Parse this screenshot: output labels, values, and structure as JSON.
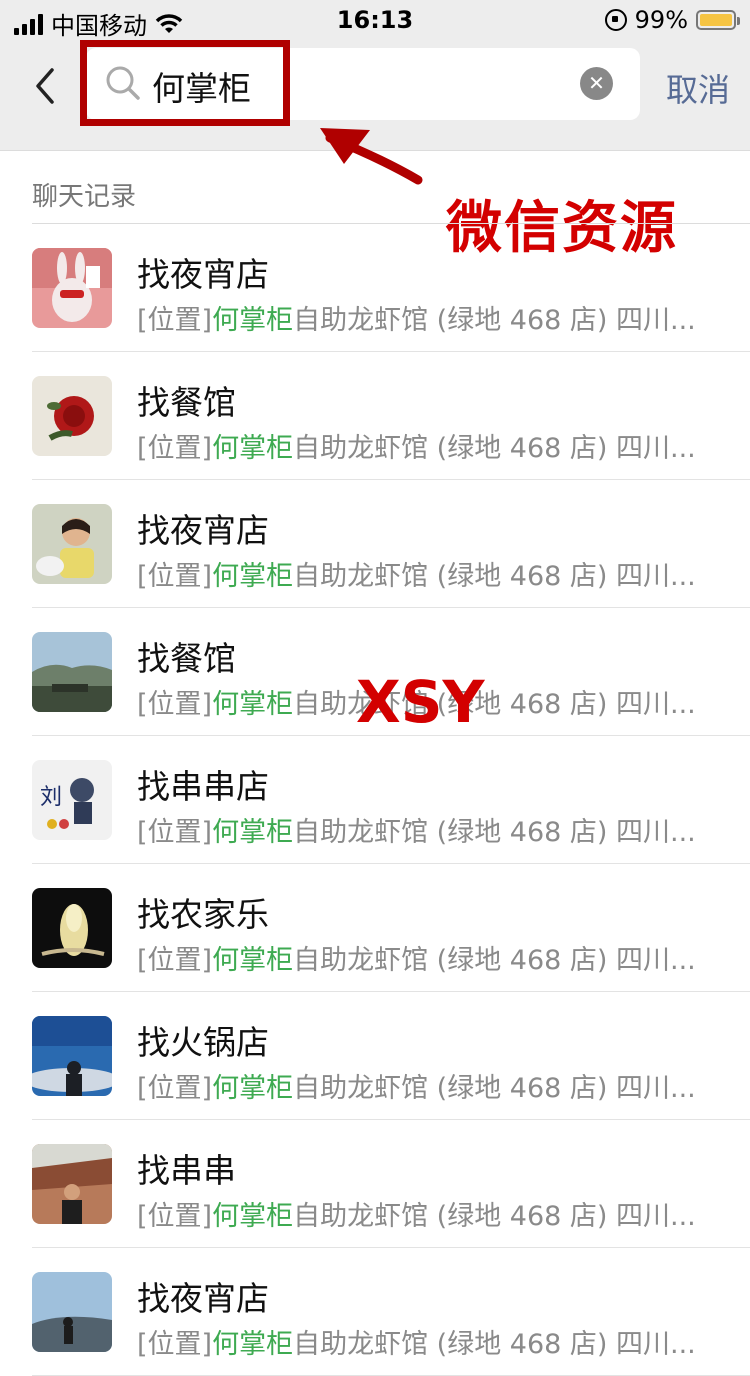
{
  "status_bar": {
    "carrier": "中国移动",
    "time": "16:13",
    "battery": "99%",
    "battery_level": 0.99
  },
  "search": {
    "query": "何掌柜",
    "cancel_label": "取消"
  },
  "annotations": {
    "title": "微信资源",
    "watermark": "XSY",
    "frame_color": "#b00000",
    "text_color": "#d30000"
  },
  "section": {
    "title": "聊天记录"
  },
  "colors": {
    "accent_link": "#576b95",
    "keyword": "#3eaa51",
    "snippet": "#8a8a8a"
  },
  "results": [
    {
      "name": "找夜宵店",
      "prefix": "[位置]",
      "keyword": "何掌柜",
      "rest": "自助龙虾馆 (绿地 468 店) 四川...",
      "avatar": "rabbit-avatar"
    },
    {
      "name": "找餐馆",
      "prefix": "[位置]",
      "keyword": "何掌柜",
      "rest": "自助龙虾馆 (绿地 468 店) 四川...",
      "avatar": "rose-avatar"
    },
    {
      "name": "找夜宵店",
      "prefix": "[位置]",
      "keyword": "何掌柜",
      "rest": "自助龙虾馆 (绿地 468 店) 四川...",
      "avatar": "child-avatar"
    },
    {
      "name": "找餐馆",
      "prefix": "[位置]",
      "keyword": "何掌柜",
      "rest": "自助龙虾馆 (绿地 468 店) 四川...",
      "avatar": "landscape-avatar"
    },
    {
      "name": "找串串店",
      "prefix": "[位置]",
      "keyword": "何掌柜",
      "rest": "自助龙虾馆 (绿地 468 店) 四川...",
      "avatar": "cartoon-avatar"
    },
    {
      "name": "找农家乐",
      "prefix": "[位置]",
      "keyword": "何掌柜",
      "rest": "自助龙虾馆 (绿地 468 店) 四川...",
      "avatar": "cabbage-avatar"
    },
    {
      "name": "找火锅店",
      "prefix": "[位置]",
      "keyword": "何掌柜",
      "rest": "自助龙虾馆 (绿地 468 店) 四川...",
      "avatar": "sky-avatar"
    },
    {
      "name": "找串串",
      "prefix": "[位置]",
      "keyword": "何掌柜",
      "rest": "自助龙虾馆 (绿地 468 店) 四川...",
      "avatar": "man-avatar"
    },
    {
      "name": "找夜宵店",
      "prefix": "[位置]",
      "keyword": "何掌柜",
      "rest": "自助龙虾馆 (绿地 468 店) 四川...",
      "avatar": "hiker-avatar"
    }
  ]
}
